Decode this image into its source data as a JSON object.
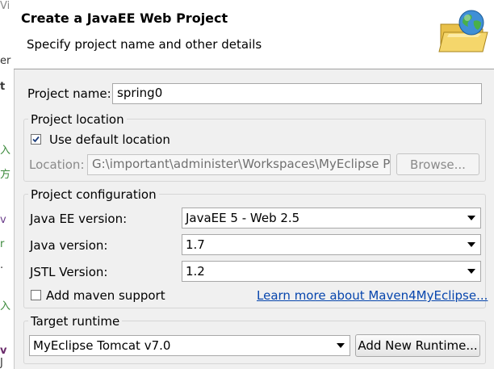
{
  "header": {
    "title": "Create a JavaEE Web Project",
    "subtitle": "Specify project name and other details",
    "icon": "folder-globe-icon"
  },
  "left_strip": {
    "fragments": [
      "Vi",
      "er",
      "t",
      "入",
      "方",
      "v",
      "r",
      "·",
      "入",
      "v",
      "J"
    ]
  },
  "project_name": {
    "label": "Project name:",
    "value": "spring0"
  },
  "project_location": {
    "title": "Project location",
    "use_default_label": "Use default location",
    "use_default_checked": true,
    "location_label": "Location:",
    "location_value": "G:\\important\\administer\\Workspaces\\MyEclipse Pr",
    "browse_label": "Browse..."
  },
  "project_configuration": {
    "title": "Project configuration",
    "javaee_label": "Java EE version:",
    "javaee_value": "JavaEE 5 - Web 2.5",
    "java_label": "Java version:",
    "java_value": "1.7",
    "jstl_label": "JSTL Version:",
    "jstl_value": "1.2",
    "maven_label": "Add maven support",
    "maven_checked": false,
    "maven_link": "Learn more about Maven4MyEclipse..."
  },
  "target_runtime": {
    "title": "Target runtime",
    "value": "MyEclipse Tomcat v7.0",
    "add_label": "Add New Runtime..."
  }
}
